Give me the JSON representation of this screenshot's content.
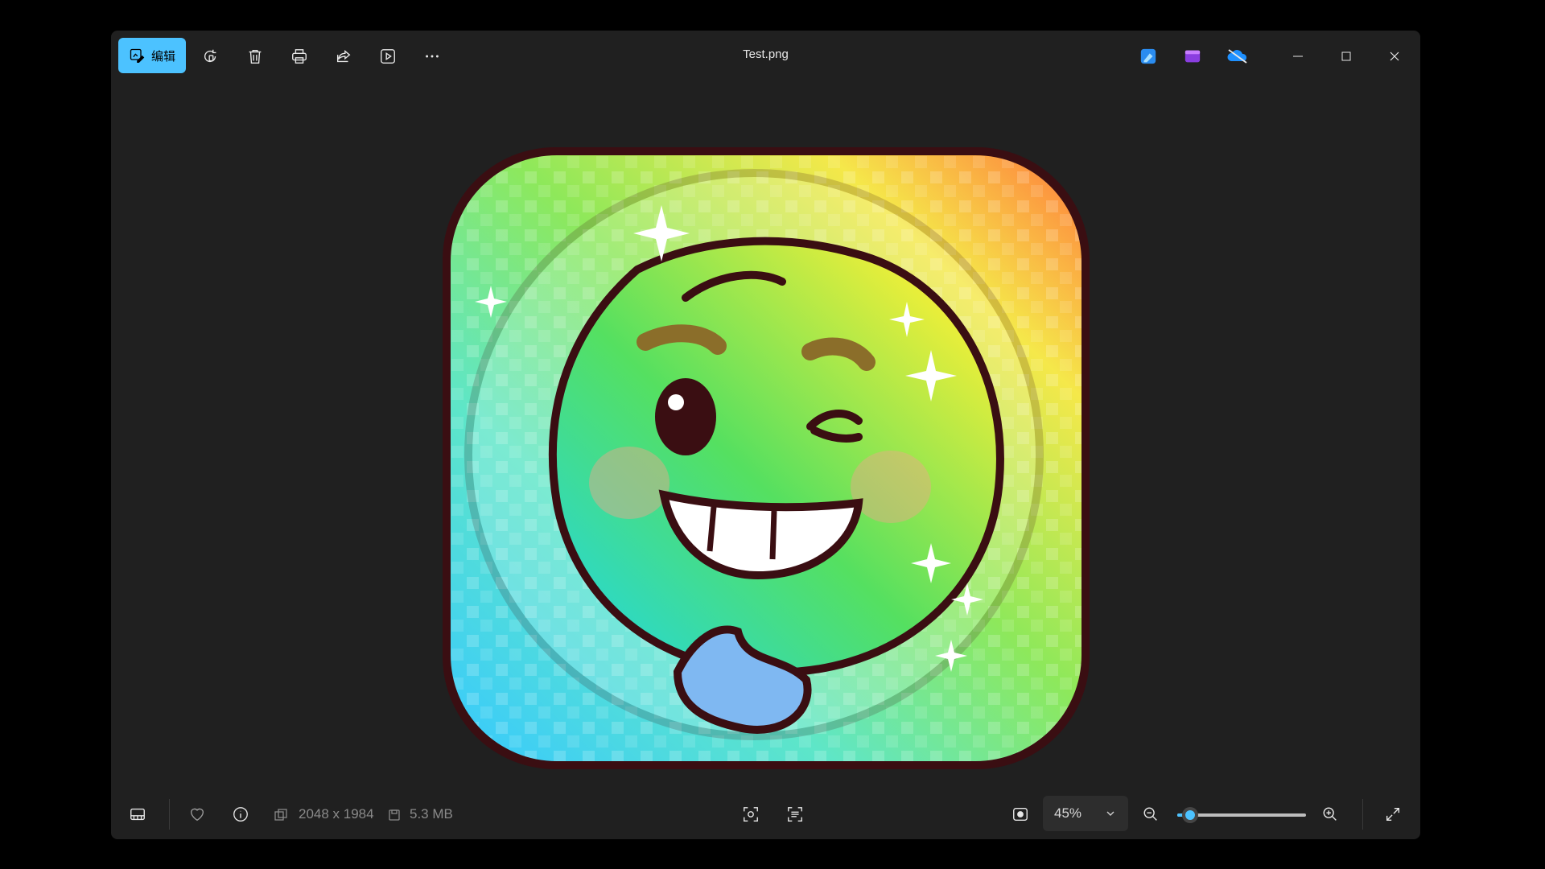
{
  "window": {
    "title": "Test.png"
  },
  "toolbar": {
    "edit_label": "编辑",
    "icons": [
      "edit-icon",
      "rotate-icon",
      "delete-icon",
      "print-icon",
      "share-icon",
      "slideshow-icon",
      "more-icon"
    ]
  },
  "apps": [
    "designer-icon",
    "clipchamp-icon",
    "onedrive-icon"
  ],
  "image": {
    "dimensions": "2048 x 1984",
    "file_size": "5.3 MB"
  },
  "zoom": {
    "value": "45%",
    "level": 0.1
  },
  "colors": {
    "accent": "#4cc2ff",
    "background": "#202020",
    "outer": "#000000"
  }
}
